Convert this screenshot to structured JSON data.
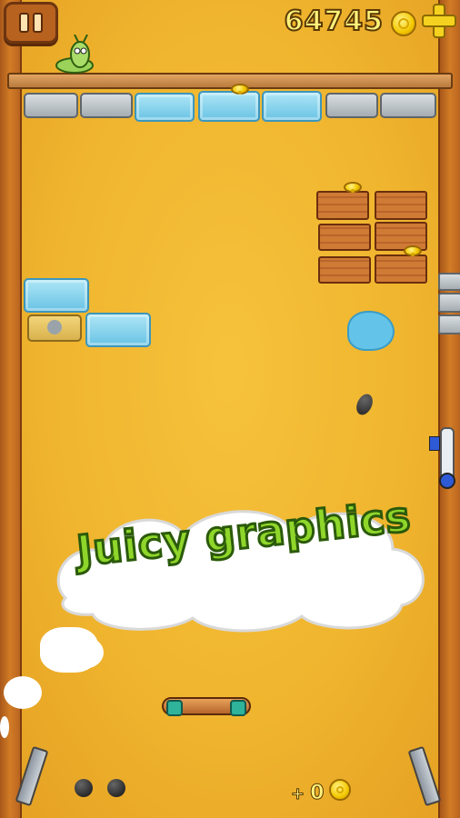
{
  "hud": {
    "score": "64745",
    "coin_bonus": "0",
    "bonus_prefix": "+"
  },
  "banner": {
    "text": "Juicy graphics"
  },
  "icons": {
    "pause": "pause-icon",
    "coin": "coin-icon",
    "add": "plus-icon"
  },
  "colors": {
    "background": "#f0b52e",
    "banner_text": "#8fd62a",
    "score_text": "#fff27a",
    "ice": "#69c3e4",
    "wood": "#cf7a35",
    "stone": "#a6adb2"
  }
}
